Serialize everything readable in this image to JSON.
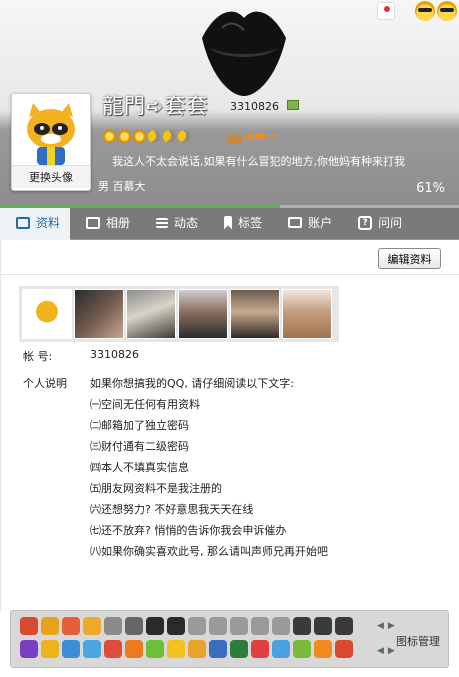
{
  "header": {
    "nickname": "龍門➪套套",
    "qq_number": "3310826",
    "vip_label": "VIP8",
    "vip_arrow": "↑",
    "signature": "我这人不太会说话,如果有什么冒犯的地方,你他妈有种来打我",
    "gender_age": "男   百慕大",
    "completion": "61%",
    "completion_value": 0.61,
    "change_avatar_label": "更换头像",
    "level_icons": [
      "sun-icon",
      "sun-icon",
      "sun-icon",
      "moon-icon",
      "moon-icon",
      "moon-icon"
    ]
  },
  "tabs": [
    {
      "label": "资料",
      "icon": "profile-card-icon",
      "active": true
    },
    {
      "label": "相册",
      "icon": "album-icon",
      "active": false
    },
    {
      "label": "动态",
      "icon": "list-icon",
      "active": false
    },
    {
      "label": "标签",
      "icon": "bookmark-icon",
      "active": false
    },
    {
      "label": "账户",
      "icon": "wallet-icon",
      "active": false
    },
    {
      "label": "问问",
      "icon": "question-icon",
      "active": false
    }
  ],
  "panel": {
    "edit_button": "编辑资料",
    "account_label": "帐     号:",
    "account_value": "3310826",
    "description_label": "个人说明",
    "description_lines": [
      "如果你想搞我的QQ, 请仔细阅读以下文字:",
      "㈠空间无任何有用资料",
      "㈡邮箱加了独立密码",
      "㈢财付通有二级密码",
      "㈣本人不填真实信息",
      "㈤朋友网资料不是我注册的",
      "㈥还想努力? 不好意思我天天在线",
      "㈦还不放弃? 悄悄的告诉你我会申诉催办",
      "㈧如果你确实喜欢此号, 那么请叫声师兄再开始吧"
    ]
  },
  "iconbar": {
    "manage_label": "图标管理",
    "colors": {
      "row1": [
        "#d84a2f",
        "#e9a21c",
        "#e85d3a",
        "#f0a828",
        "#8a8a8a",
        "#666",
        "#2a2a2a",
        "#2a2a2a",
        "#9a9a9a",
        "#9a9a9a",
        "#9a9a9a",
        "#9a9a9a",
        "#9a9a9a",
        "#3a3a3a",
        "#3a3a3a",
        "#3a3a3a"
      ],
      "row2": [
        "#7a3fc1",
        "#f0b21c",
        "#3b8fd6",
        "#4aa6e0",
        "#e04d3f",
        "#ee7a20",
        "#6cc038",
        "#f4c01c",
        "#e8a42a",
        "#3a6fc0",
        "#2c7d3a",
        "#e04040",
        "#4aa0e0",
        "#7ab93a",
        "#f08a20",
        "#d84a2f"
      ]
    }
  }
}
